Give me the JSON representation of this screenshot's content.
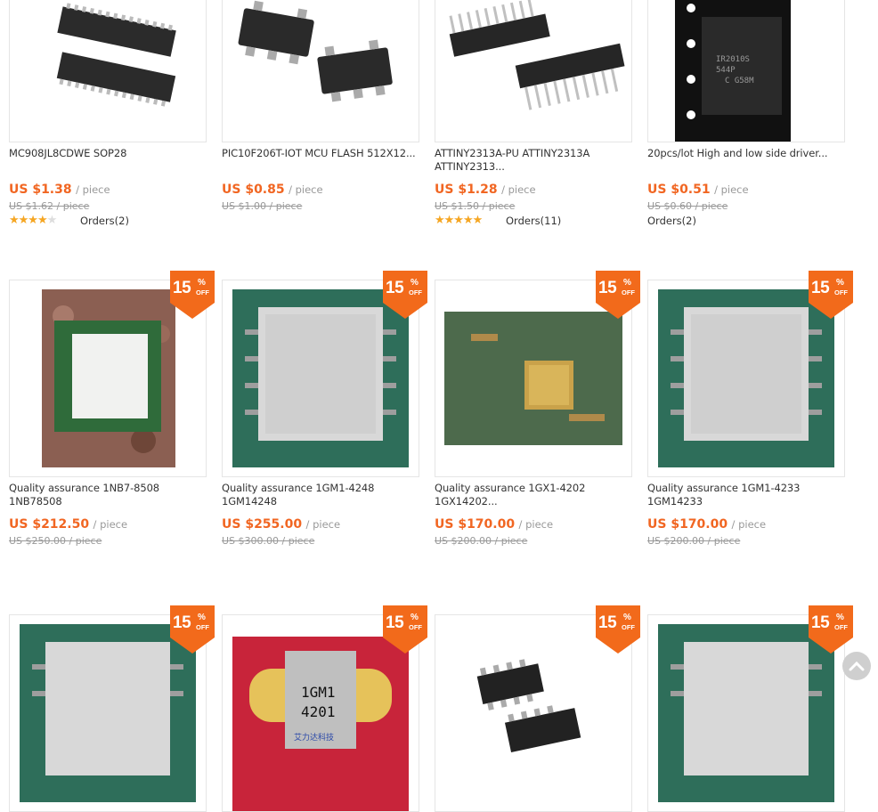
{
  "products": [
    {
      "title": "MC908JL8CDWE SOP28",
      "price": "US $1.38",
      "unit": "/ piece",
      "orig": "US $1.62 / piece",
      "stars": 4,
      "orders": "Orders(2)",
      "badge": null
    },
    {
      "title": "PIC10F206T-IOT MCU FLASH 512X12...",
      "price": "US $0.85",
      "unit": "/ piece",
      "orig": "US $1.00 / piece",
      "stars": 0,
      "orders": "",
      "badge": null
    },
    {
      "title": "ATTINY2313A-PU ATTINY2313A ATTINY2313...",
      "price": "US $1.28",
      "unit": "/ piece",
      "orig": "US $1.50 / piece",
      "stars": 5,
      "orders": "Orders(11)",
      "badge": null
    },
    {
      "title": "20pcs/lot High and low side driver...",
      "price": "US $0.51",
      "unit": "/ piece",
      "orig": "US $0.60 / piece",
      "stars": 0,
      "orders": "Orders(2)",
      "badge": null
    },
    {
      "title": "Quality assurance 1NB7-8508 1NB78508",
      "price": "US $212.50",
      "unit": "/ piece",
      "orig": "US $250.00 / piece",
      "stars": 0,
      "orders": "",
      "badge": "15"
    },
    {
      "title": "Quality assurance 1GM1-4248 1GM14248",
      "price": "US $255.00",
      "unit": "/ piece",
      "orig": "US $300.00 / piece",
      "stars": 0,
      "orders": "",
      "badge": "15"
    },
    {
      "title": "Quality assurance 1GX1-4202 1GX14202...",
      "price": "US $170.00",
      "unit": "/ piece",
      "orig": "US $200.00 / piece",
      "stars": 0,
      "orders": "",
      "badge": "15"
    },
    {
      "title": "Quality assurance 1GM1-4233 1GM14233",
      "price": "US $170.00",
      "unit": "/ piece",
      "orig": "US $200.00 / piece",
      "stars": 0,
      "orders": "",
      "badge": "15"
    },
    {
      "badge": "15"
    },
    {
      "badge": "15"
    },
    {
      "badge": "15"
    },
    {
      "badge": "15"
    }
  ],
  "badge_text": {
    "pct": "%",
    "off": "OFF"
  },
  "chip_labels": {
    "ic4": "IR2010S 544P C G58M",
    "gm4201": "1GM1 4201",
    "gm_brand": "艾力达科技"
  },
  "colors": {
    "price": "#f16622",
    "badge": "#f26a1b",
    "stars": "#f5a623"
  },
  "icons": {
    "back_to_top": "chevron-up-icon"
  }
}
